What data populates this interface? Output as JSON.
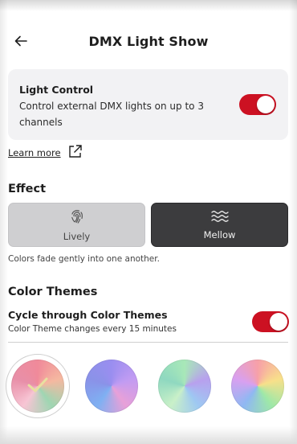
{
  "header": {
    "title": "DMX Light Show"
  },
  "light_control": {
    "title": "Light Control",
    "description": "Control external DMX lights on up to 3 channels",
    "enabled": true
  },
  "learn_more": {
    "label": "Learn more"
  },
  "effect": {
    "title": "Effect",
    "options": [
      {
        "label": "Lively",
        "icon": "fingerprint-icon",
        "selected": false
      },
      {
        "label": "Mellow",
        "icon": "waves-icon",
        "selected": true
      }
    ],
    "hint": "Colors fade gently into one another."
  },
  "color_themes": {
    "title": "Color Themes",
    "cycle_label": "Cycle through Color Themes",
    "cycle_desc": "Color Theme changes every 15 minutes",
    "cycle_enabled": true,
    "themes": [
      {
        "name": "theme-1",
        "selected": true,
        "colors": [
          "#f08a9a",
          "#f5b8a0",
          "#9ed6b2",
          "#f7c5d4",
          "#e88fa8"
        ]
      },
      {
        "name": "theme-2",
        "selected": false,
        "colors": [
          "#9a8ef0",
          "#c29cf2",
          "#e8a0d8",
          "#7fb0f2",
          "#8a92e8"
        ]
      },
      {
        "name": "theme-3",
        "selected": false,
        "colors": [
          "#a8e8b8",
          "#b8a0ee",
          "#9ec8f2",
          "#c9f0c8",
          "#8fd8c0"
        ]
      },
      {
        "name": "theme-4",
        "selected": false,
        "colors": [
          "#f7a0a8",
          "#f8e08a",
          "#9ee8a8",
          "#8fb8f2",
          "#d8a0f0"
        ]
      }
    ]
  },
  "colors": {
    "accent": "#cc1122",
    "card_bg": "#f2f2f4",
    "selected_effect_bg": "#3c3c3e"
  }
}
